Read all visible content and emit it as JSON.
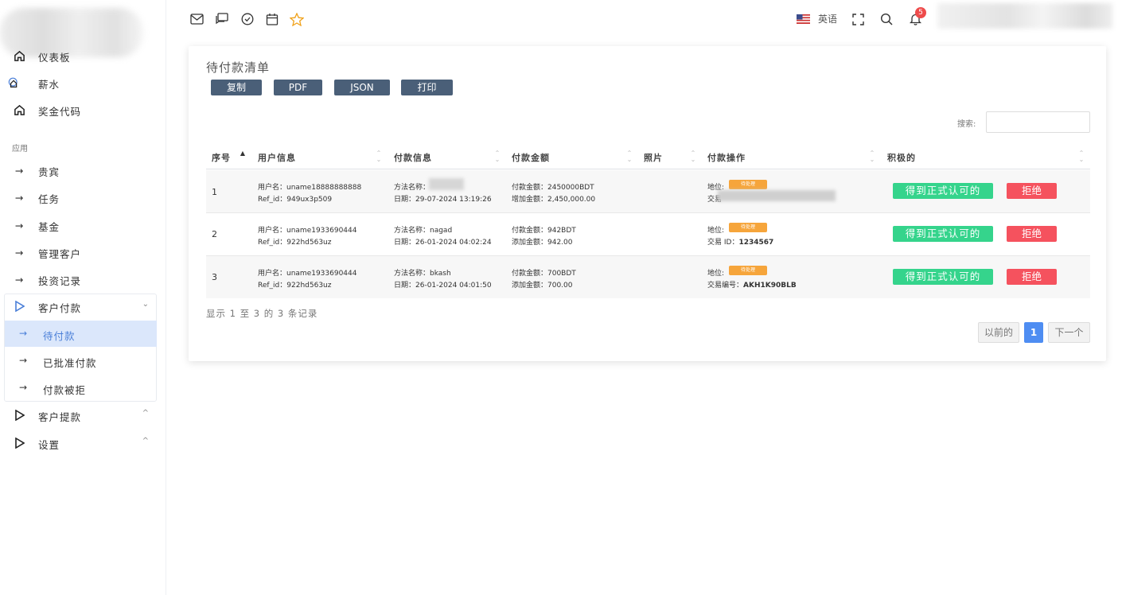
{
  "sidebar": {
    "top_items": [
      {
        "label": "仪表板",
        "icon": "home-icon"
      },
      {
        "label": "薪水",
        "icon": "salary-icon"
      },
      {
        "label": "奖金代码",
        "icon": "home-icon"
      }
    ],
    "section_label": "应用",
    "items": [
      {
        "label": "贵宾"
      },
      {
        "label": "任务"
      },
      {
        "label": "基金"
      },
      {
        "label": "管理客户"
      },
      {
        "label": "投资记录"
      }
    ],
    "customer_payments": {
      "label": "客户付款",
      "chevron": "⌄"
    },
    "sub_items": [
      {
        "label": "待付款",
        "active": true
      },
      {
        "label": "已批准付款"
      },
      {
        "label": "付款被拒"
      }
    ],
    "withdrawals": {
      "label": "客户提款",
      "chevron": "^"
    },
    "settings": {
      "label": "设置",
      "chevron": "^"
    }
  },
  "header": {
    "language": "英语",
    "notification_count": "5"
  },
  "card": {
    "title": "待付款清单",
    "export_buttons": [
      "复制",
      "PDF",
      "JSON",
      "打印"
    ],
    "search_label": "搜索:",
    "columns": [
      "序号",
      "用户信息",
      "付款信息",
      "付款金额",
      "照片",
      "付款操作",
      "积极的"
    ],
    "rows": [
      {
        "no": "1",
        "username": "用户名：uname18888888888",
        "ref": "Ref_id：949ux3p509",
        "method": "方法名称：",
        "date": "日期：29-07-2024 13:19:26",
        "pay_amount": "付款金额：2450000BDT",
        "add_amount": "增加金额：2,450,000.00",
        "status_label": "地位:",
        "status": "待处理",
        "txn": "交易",
        "approve": "得到正式认可的",
        "reject": "拒绝"
      },
      {
        "no": "2",
        "username": "用户名：uname1933690444",
        "ref": "Ref_id：922hd563uz",
        "method": "方法名称：nagad",
        "date": "日期：26-01-2024 04:02:24",
        "pay_amount": "付款金额：942BDT",
        "add_amount": "添加金额：942.00",
        "status_label": "地位:",
        "status": "待处理",
        "txn": "交易 ID：",
        "txn_value": "1234567",
        "approve": "得到正式认可的",
        "reject": "拒绝"
      },
      {
        "no": "3",
        "username": "用户名：uname1933690444",
        "ref": "Ref_id：922hd563uz",
        "method": "方法名称：bkash",
        "date": "日期：26-01-2024 04:01:50",
        "pay_amount": "付款金额：700BDT",
        "add_amount": "添加金额：700.00",
        "status_label": "地位:",
        "status": "待处理",
        "txn": "交易编号：",
        "txn_value": "AKH1K90BLB",
        "approve": "得到正式认可的",
        "reject": "拒绝"
      }
    ],
    "info": "显示 1 至 3 的 3 条记录",
    "pagination": {
      "prev": "以前的",
      "current": "1",
      "next": "下一个"
    }
  },
  "colors": {
    "accent": "#4e8df2",
    "approve": "#35d48c",
    "reject": "#f5525e",
    "pending": "#f6a53b",
    "export": "#4a5f78"
  }
}
